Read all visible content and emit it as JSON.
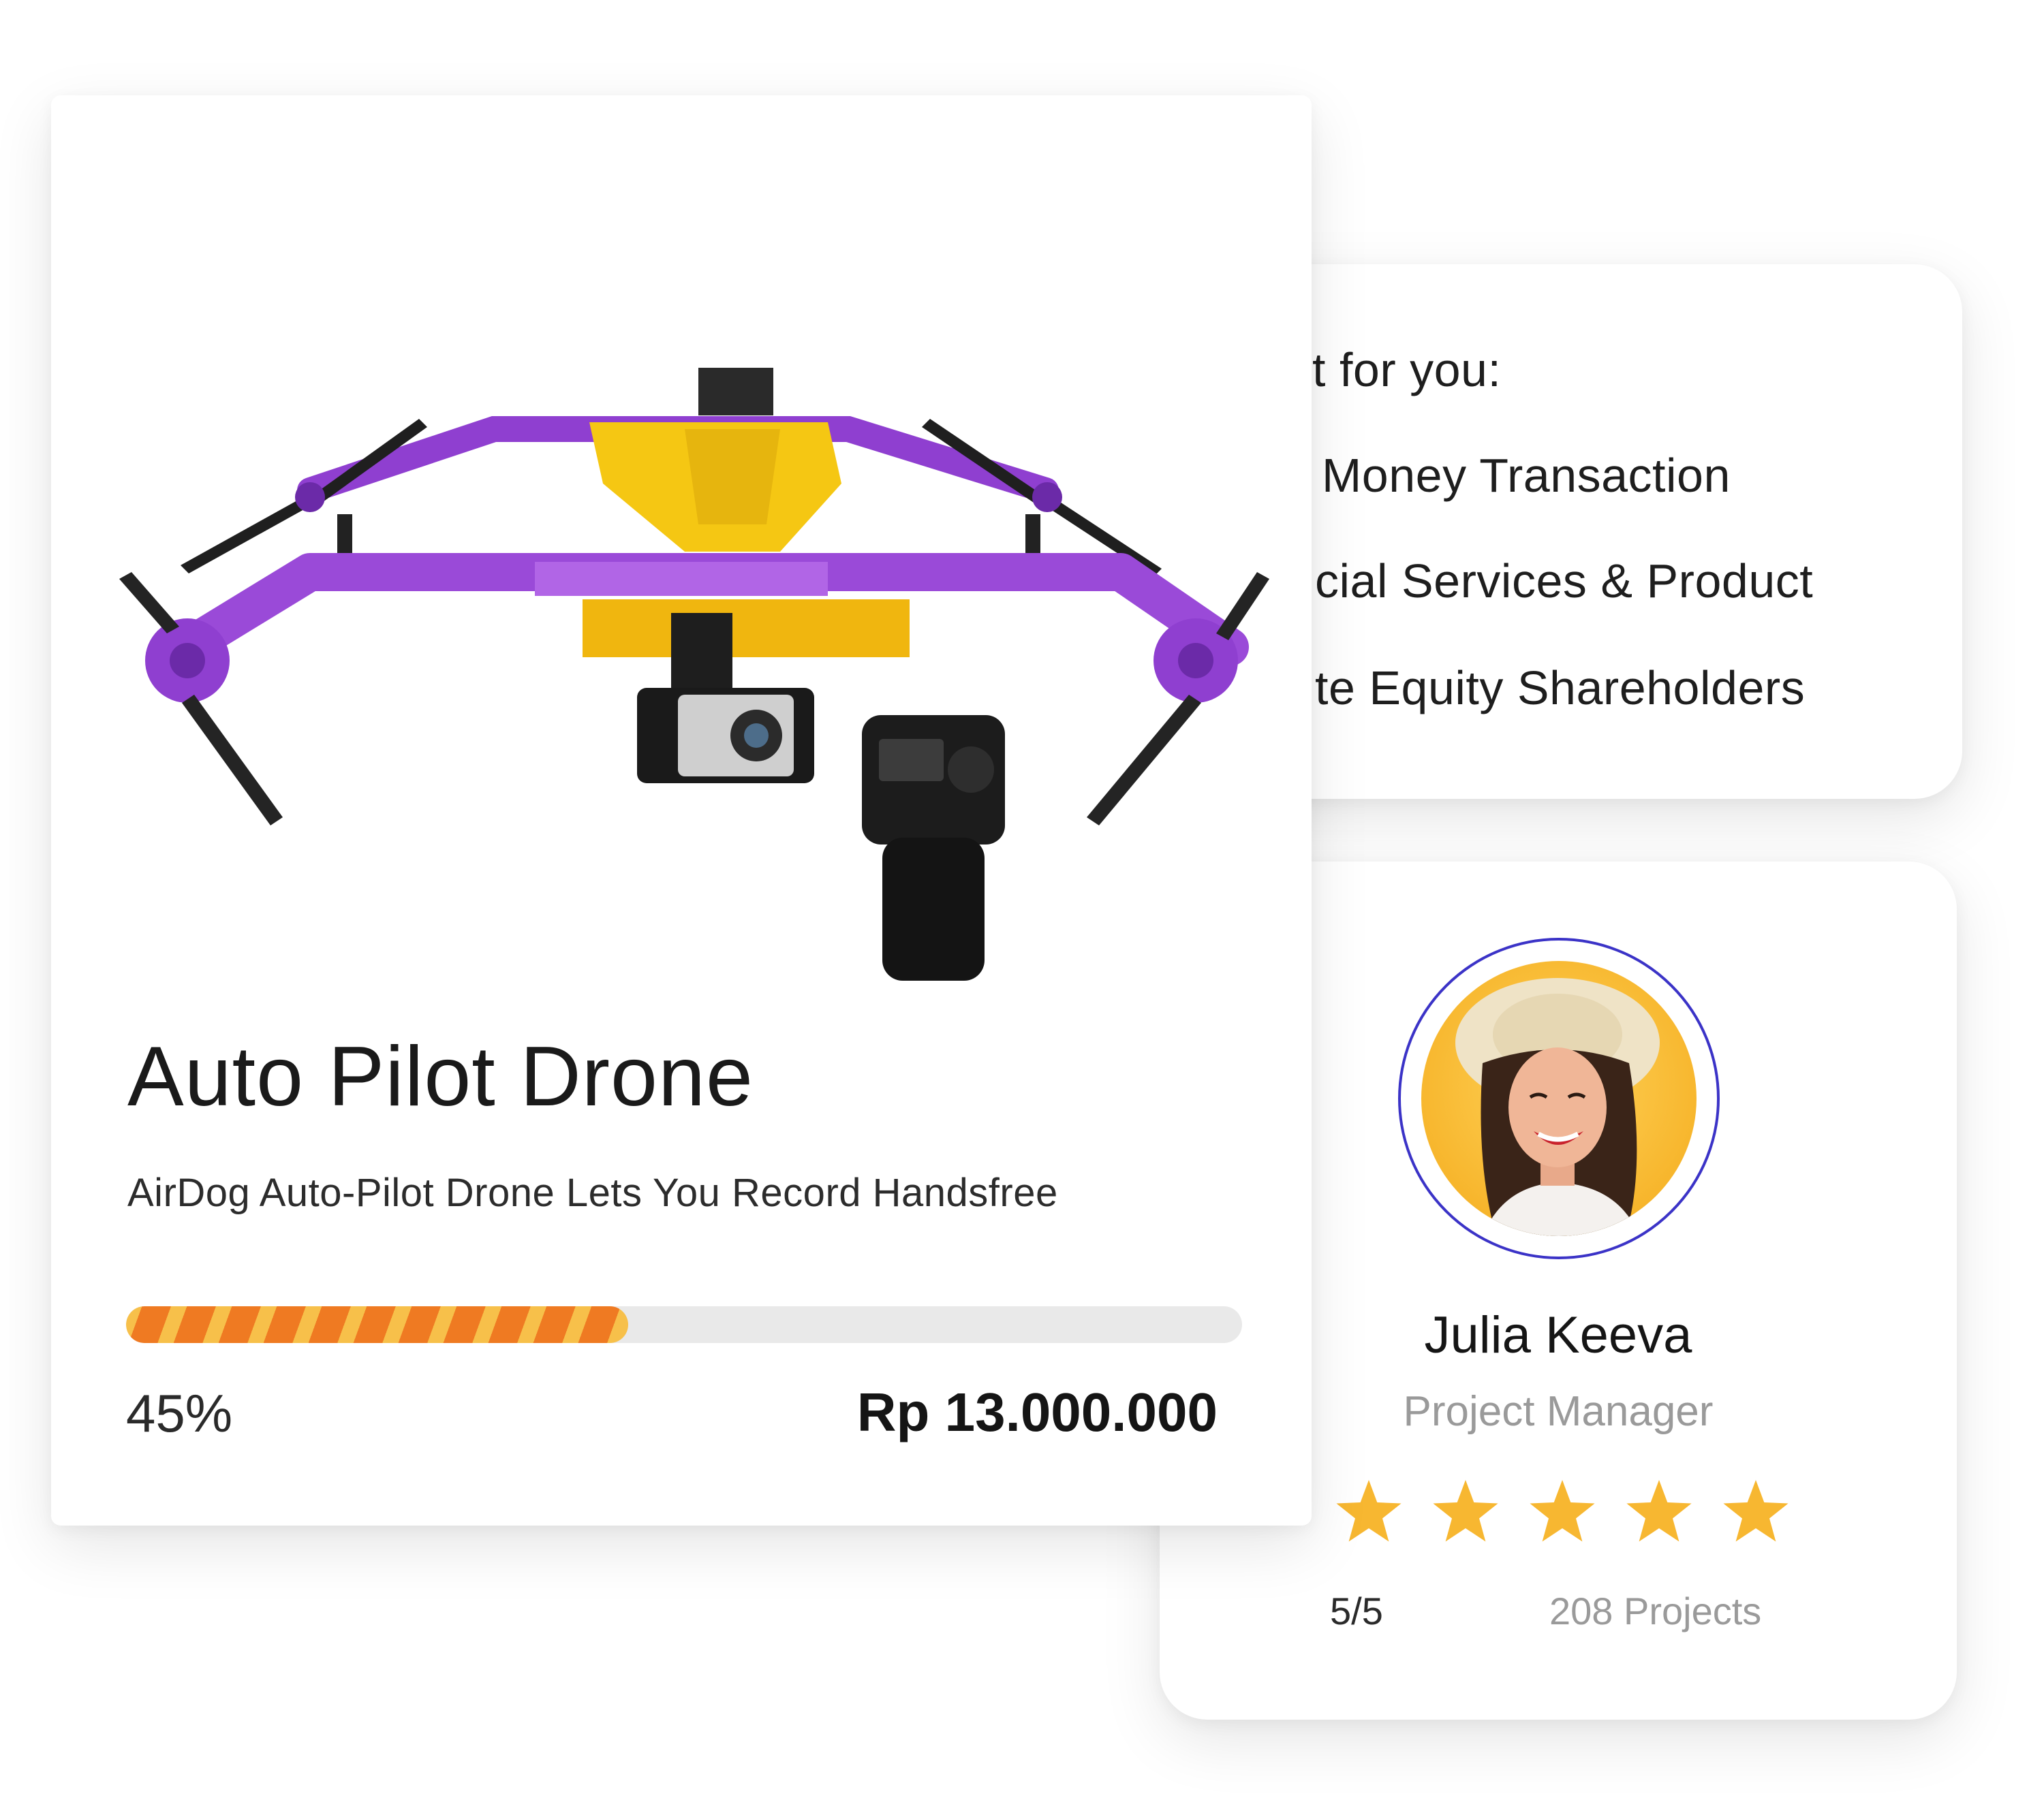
{
  "product": {
    "title": "Auto Pilot Drone",
    "subtitle": "AirDog Auto-Pilot Drone Lets You Record Handsfree",
    "progress_percent": 45,
    "progress_label": "45%",
    "price": "Rp 13.000.000",
    "image_icon": "drone-image"
  },
  "benefits": {
    "lines": [
      "it for you:",
      "Money Transaction",
      "cial Services & Product",
      "te Equity Shareholders"
    ]
  },
  "profile": {
    "name": "Julia Keeva",
    "role": "Project Manager",
    "rating_value": 5,
    "rating_max": 5,
    "rating_label": "5/5",
    "projects_label": "208 Projects"
  },
  "colors": {
    "accent_ring": "#3b33c7",
    "progress_orange": "#ef7a22",
    "progress_yellow": "#f7c04a",
    "star": "#f7b731",
    "drone_purple": "#8f3fd0",
    "drone_yellow": "#f5c713"
  }
}
